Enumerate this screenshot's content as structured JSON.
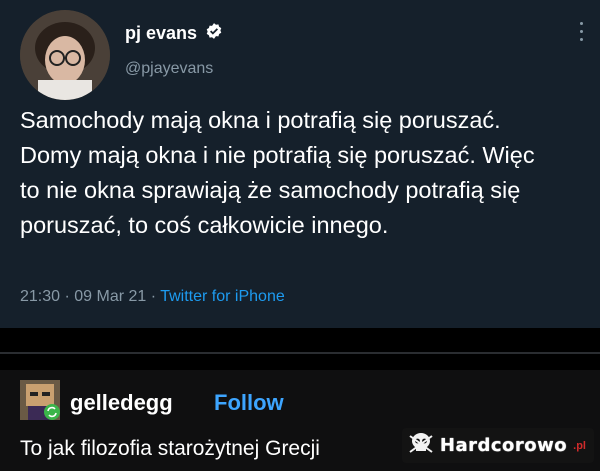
{
  "tweet": {
    "author_name": "pj evans",
    "handle": "@pjayevans",
    "text": "Samochody mają okna i potrafią się poruszać. Domy mają okna i nie potrafią się poruszać. Więc to nie okna sprawiają że samochody potrafią się poruszać, to coś całkowicie innego.",
    "date_time": "21:30 · 09 Mar 21 · ",
    "source": "Twitter for iPhone"
  },
  "comment": {
    "username": "gelledegg",
    "follow_label": "Follow",
    "text": "To jak filozofia starożytnej Grecji"
  },
  "watermark": {
    "name": "Hardcorowo",
    "tld": ".pl"
  },
  "colors": {
    "tweet_bg": "#15202b",
    "secondary_text": "#8899a6",
    "link_blue": "#1d9bf0",
    "follow_blue": "#3da5ff",
    "verified_badge": "#ffffff"
  }
}
